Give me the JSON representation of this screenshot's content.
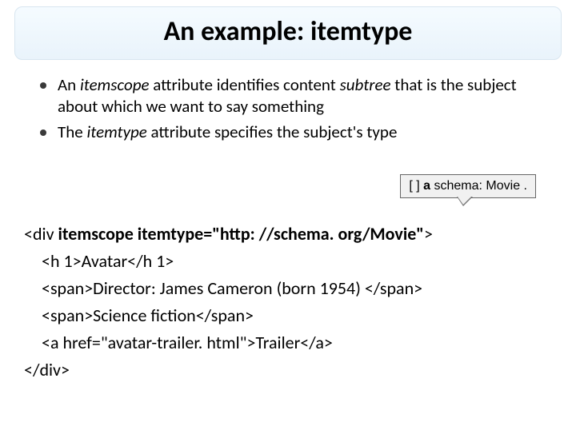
{
  "title": "An example: itemtype",
  "bullets": [
    {
      "pre": "An ",
      "em1": "itemscope",
      "mid": " attribute identifies content ",
      "em2": "subtree",
      "post": " that is the subject about which we want to say something"
    },
    {
      "pre": "The ",
      "em1": "itemtype",
      "mid": " attribute specifies the subject's type",
      "em2": "",
      "post": ""
    }
  ],
  "callout": {
    "lead": "[ ] ",
    "bold": "a",
    "rest": " schema: Movie ."
  },
  "code": {
    "l1_a": "<div ",
    "l1_b": "itemscope itemtype=\"http: //schema. org/Movie\"",
    "l1_c": ">",
    "l2": "<h 1>Avatar</h 1>",
    "l3": "<span>Director: James Cameron (born 1954) </span>",
    "l4": "<span>Science fiction</span>",
    "l5": "<a href=\"avatar-trailer. html\">Trailer</a>",
    "l6": "</div>"
  }
}
